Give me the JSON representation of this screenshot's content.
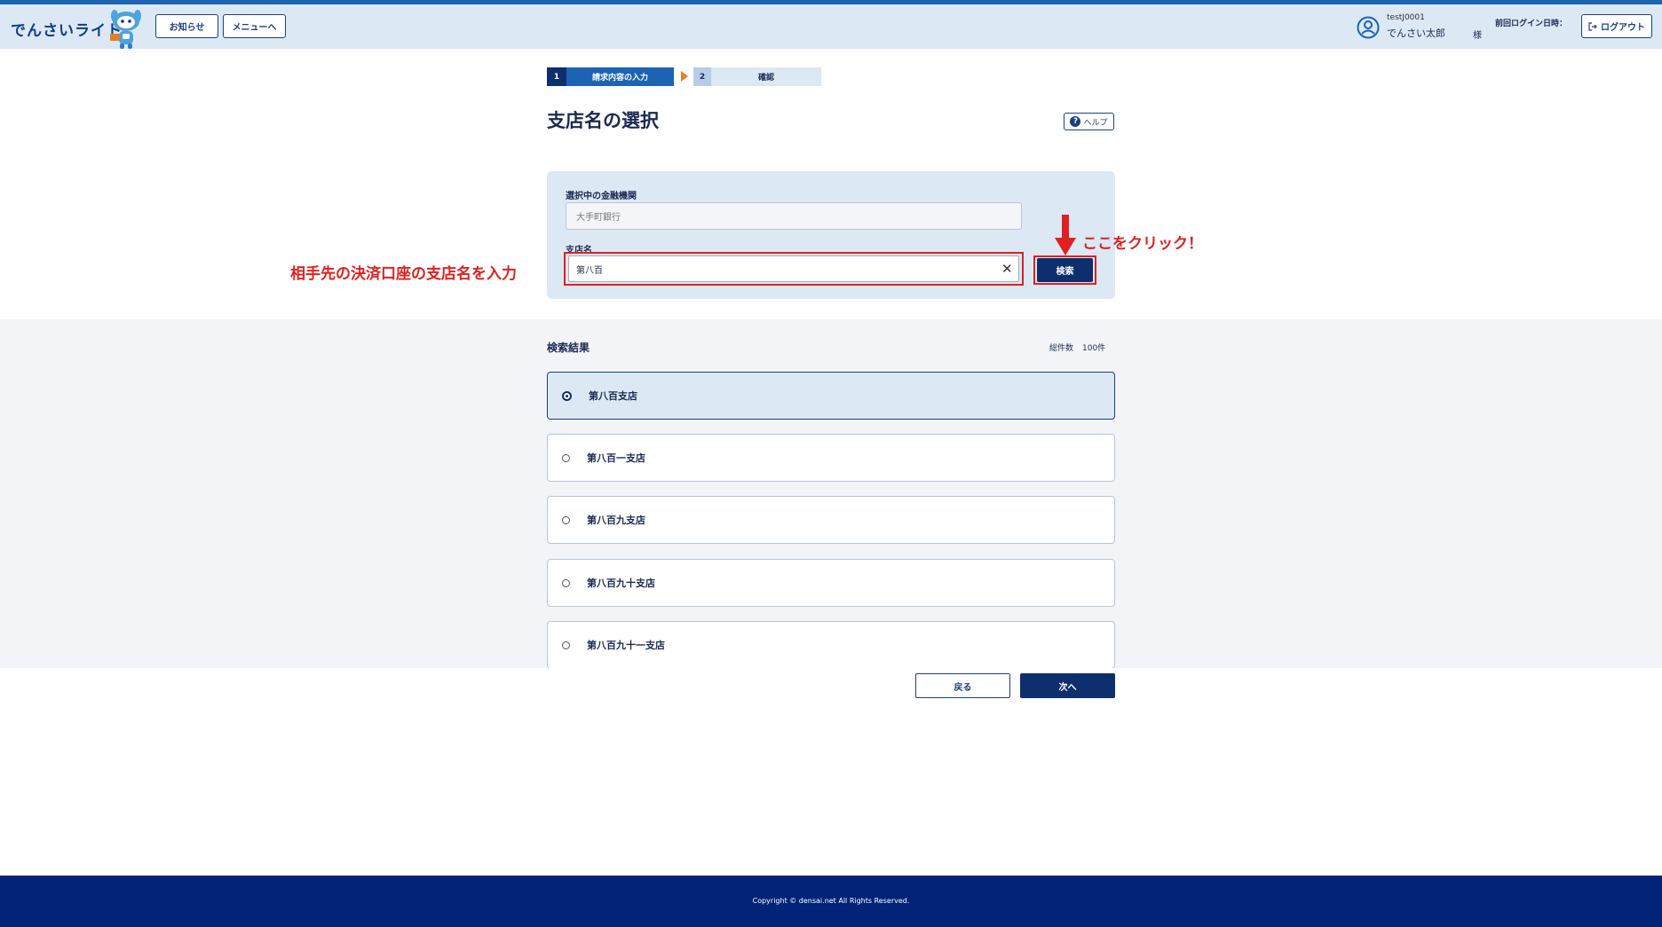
{
  "header": {
    "logo_text": "でんさいライト",
    "news_label": "お知らせ",
    "menu_label": "メニューへ",
    "user_id": "testJ0001",
    "user_name": "でんさい太郎",
    "honorific": "様",
    "last_login_label": "前回ログイン日時：",
    "logout_label": "ログアウト"
  },
  "steps": [
    {
      "num": "1",
      "label": "請求内容の入力",
      "active": true
    },
    {
      "num": "2",
      "label": "確認",
      "active": false
    }
  ],
  "page": {
    "title": "支店名の選択",
    "help_label": "ヘルプ"
  },
  "search": {
    "bank_label": "選択中の金融機関",
    "bank_placeholder": "大手町銀行",
    "branch_label": "支店名",
    "branch_value": "第八百",
    "search_button": "検索"
  },
  "annotations": {
    "click_here": "ここをクリック！",
    "input_hint": "相手先の決済口座の支店名を入力"
  },
  "results": {
    "title": "検索結果",
    "total_label": "総件数",
    "total_count": "100件",
    "items": [
      {
        "label": "第八百支店",
        "selected": true
      },
      {
        "label": "第八百一支店",
        "selected": false
      },
      {
        "label": "第八百九支店",
        "selected": false
      },
      {
        "label": "第八百九十支店",
        "selected": false
      },
      {
        "label": "第八百九十一支店",
        "selected": false
      }
    ]
  },
  "actions": {
    "back_label": "戻る",
    "next_label": "次へ"
  },
  "footer": {
    "copyright": "Copyright © densai.net All Rights Reserved."
  },
  "colors": {
    "navy": "#0e2f6d",
    "brand_blue": "#1c63b4",
    "header_bg": "#dce8f3",
    "annotation_red": "#e02020",
    "step_arrow": "#e67e22",
    "footer_bg": "#002378"
  }
}
